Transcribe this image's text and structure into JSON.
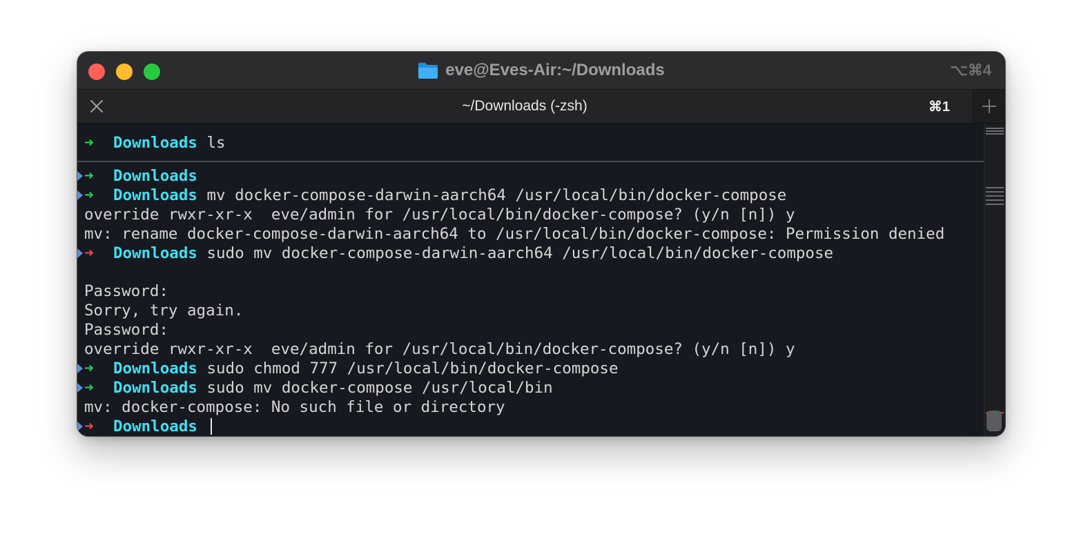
{
  "window": {
    "title": "eve@Eves-Air:~/Downloads",
    "title_shortcut": "⌥⌘4"
  },
  "tab": {
    "title": "~/Downloads (-zsh)",
    "shortcut": "⌘1"
  },
  "prompt": {
    "arrow": "➜",
    "dir": "Downloads"
  },
  "pinned": {
    "dir": "Downloads",
    "command": " ls"
  },
  "lines": [
    {
      "type": "prompt",
      "status": "ok",
      "dir": "Downloads",
      "command": ""
    },
    {
      "type": "prompt",
      "status": "ok",
      "dir": "Downloads",
      "command": " mv docker-compose-darwin-aarch64 /usr/local/bin/docker-compose"
    },
    {
      "type": "output",
      "text": "override rwxr-xr-x  eve/admin for /usr/local/bin/docker-compose? (y/n [n]) y"
    },
    {
      "type": "output",
      "text": "mv: rename docker-compose-darwin-aarch64 to /usr/local/bin/docker-compose: Permission denied"
    },
    {
      "type": "prompt",
      "status": "err",
      "dir": "Downloads",
      "command": " sudo mv docker-compose-darwin-aarch64 /usr/local/bin/docker-compose"
    },
    {
      "type": "output",
      "text": ""
    },
    {
      "type": "output",
      "text": "Password:"
    },
    {
      "type": "output",
      "text": "Sorry, try again."
    },
    {
      "type": "output",
      "text": "Password:"
    },
    {
      "type": "output",
      "text": "override rwxr-xr-x  eve/admin for /usr/local/bin/docker-compose? (y/n [n]) y"
    },
    {
      "type": "prompt",
      "status": "ok",
      "dir": "Downloads",
      "command": " sudo chmod 777 /usr/local/bin/docker-compose"
    },
    {
      "type": "prompt",
      "status": "ok",
      "dir": "Downloads",
      "command": " sudo mv docker-compose /usr/local/bin"
    },
    {
      "type": "output",
      "text": "mv: docker-compose: No such file or directory"
    },
    {
      "type": "prompt",
      "status": "err",
      "dir": "Downloads",
      "command": " ",
      "cursor": true
    }
  ],
  "colors": {
    "prompt_ok": "#27d05a",
    "prompt_err": "#e34c4c",
    "dir": "#41dff5",
    "text": "#d6d6d6",
    "background": "#16191f"
  }
}
